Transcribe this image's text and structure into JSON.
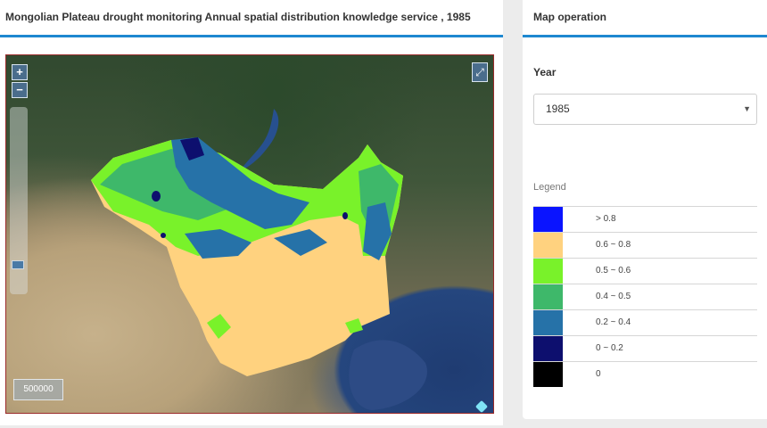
{
  "left_panel": {
    "title": "Mongolian Plateau drought monitoring Annual spatial distribution knowledge service , 1985"
  },
  "map": {
    "zoom_in_label": "+",
    "zoom_out_label": "−",
    "fullscreen_label": "⤢",
    "scale_text": "500000"
  },
  "right_panel": {
    "title": "Map operation",
    "year_label": "Year",
    "year_selected": "1985",
    "legend_title": "Legend",
    "legend": [
      {
        "label": "> 0.8",
        "color": "#0a14ff"
      },
      {
        "label": "0.6 ~ 0.8",
        "color": "#ffd27f"
      },
      {
        "label": "0.5 ~ 0.6",
        "color": "#79f22a"
      },
      {
        "label": "0.4 ~ 0.5",
        "color": "#3eb86a"
      },
      {
        "label": "0.2 ~ 0.4",
        "color": "#2672a8"
      },
      {
        "label": "0 ~ 0.2",
        "color": "#0d0f6e"
      },
      {
        "label": "0",
        "color": "#000000"
      }
    ]
  }
}
